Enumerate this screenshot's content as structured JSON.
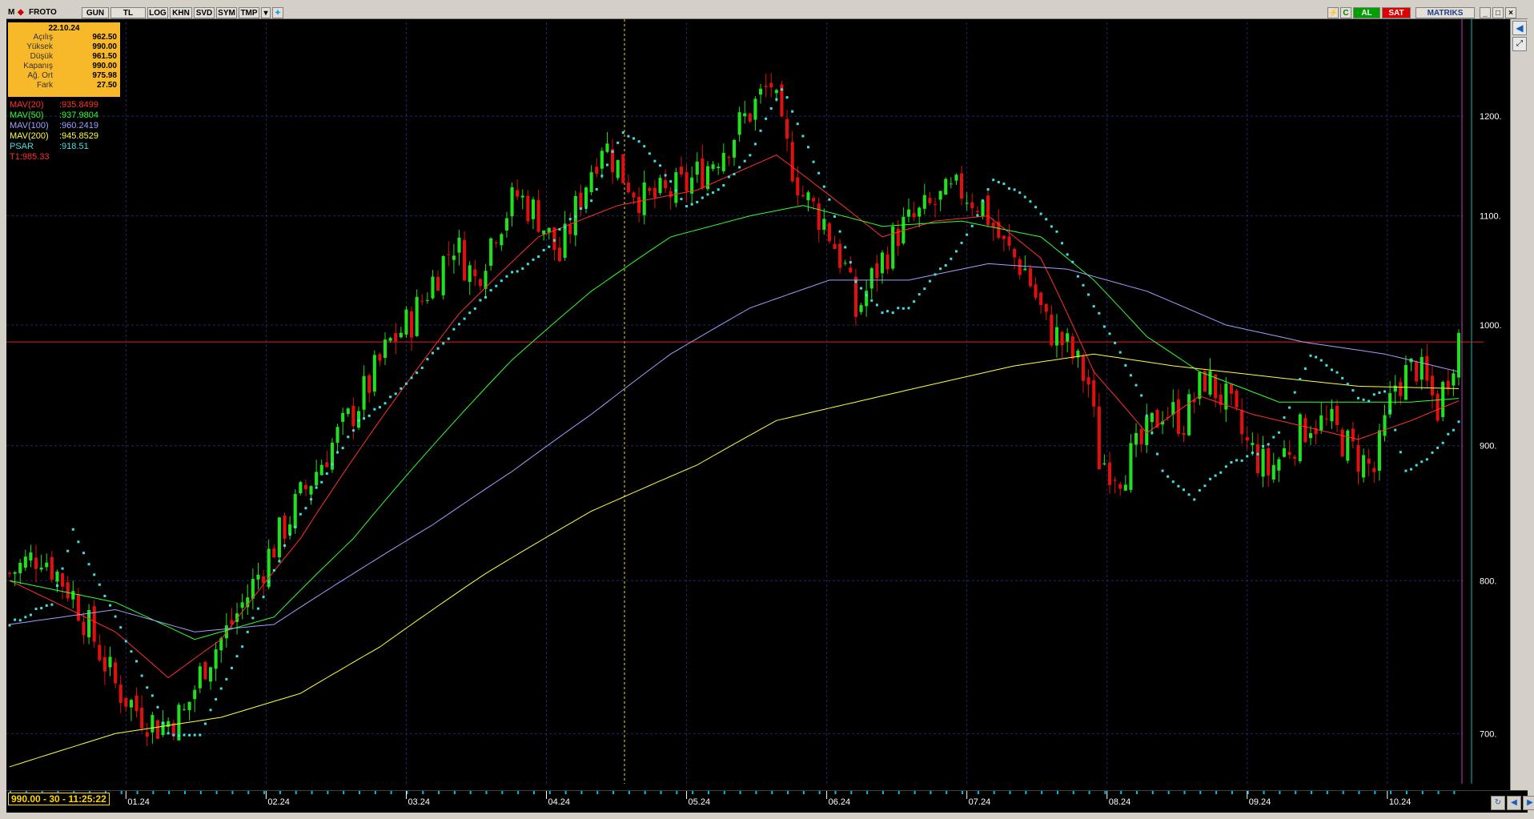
{
  "toolbar": {
    "logo": "M",
    "symbol": "FROTO",
    "buttons": [
      "GUN",
      "TL",
      "LOG",
      "KHN",
      "SVD",
      "SYM",
      "TMP"
    ],
    "right_buttons": {
      "alert": "C",
      "buy": "AL",
      "sell": "SAT"
    },
    "brand": "MATRIKS",
    "colors": {
      "buy": "#00a000",
      "sell": "#e00000"
    }
  },
  "info_box": {
    "date": "22.10.24",
    "rows": [
      {
        "label": "Açılış",
        "value": "962.50"
      },
      {
        "label": "Yüksek",
        "value": "990.00"
      },
      {
        "label": "Düşük",
        "value": "961.50"
      },
      {
        "label": "Kapanış",
        "value": "990.00"
      },
      {
        "label": "Ağ. Ort",
        "value": "975.98"
      },
      {
        "label": "Fark",
        "value": "27.50"
      }
    ]
  },
  "legend": [
    {
      "name": "MAV(20)",
      "value": ":935.8499",
      "color": "#ff3030"
    },
    {
      "name": "MAV(50)",
      "value": ":937.9804",
      "color": "#30ff30"
    },
    {
      "name": "MAV(100)",
      "value": ":960.2419",
      "color": "#a0a0ff"
    },
    {
      "name": "MAV(200)",
      "value": ":945.8529",
      "color": "#ffff40"
    },
    {
      "name": "PSAR",
      "value": ":918.51",
      "color": "#40e0e0"
    },
    {
      "name": "T1:985.33",
      "value": "",
      "color": "#ff3030"
    }
  ],
  "status": {
    "readout": "990.00 - 30 - 11:25:22"
  },
  "chart_data": {
    "type": "candlestick",
    "y_scale": "log",
    "ylim": [
      670,
      1270
    ],
    "y_ticks": [
      "1200.",
      "1100.",
      "1000.",
      "900.",
      "800.",
      "700."
    ],
    "x_ticks": [
      "01.24",
      "02.24",
      "03.24",
      "04.24",
      "05.24",
      "06.24",
      "07.24",
      "08.24",
      "09.24",
      "10.24"
    ],
    "horizontal_line": {
      "label": "T1:985.33",
      "value": 985.33
    },
    "grid": true,
    "close_path": [
      [
        0,
        805
      ],
      [
        6,
        820
      ],
      [
        12,
        790
      ],
      [
        16,
        760
      ],
      [
        20,
        730
      ],
      [
        24,
        715
      ],
      [
        28,
        705
      ],
      [
        33,
        712
      ],
      [
        37,
        745
      ],
      [
        41,
        765
      ],
      [
        45,
        790
      ],
      [
        50,
        825
      ],
      [
        55,
        860
      ],
      [
        60,
        895
      ],
      [
        64,
        920
      ],
      [
        68,
        950
      ],
      [
        72,
        985
      ],
      [
        76,
        1005
      ],
      [
        80,
        1040
      ],
      [
        84,
        1075
      ],
      [
        88,
        1040
      ],
      [
        92,
        1090
      ],
      [
        96,
        1120
      ],
      [
        100,
        1100
      ],
      [
        104,
        1060
      ],
      [
        108,
        1120
      ],
      [
        112,
        1175
      ],
      [
        116,
        1140
      ],
      [
        120,
        1115
      ],
      [
        124,
        1120
      ],
      [
        128,
        1130
      ],
      [
        132,
        1150
      ],
      [
        136,
        1175
      ],
      [
        140,
        1205
      ],
      [
        144,
        1235
      ],
      [
        146,
        1180
      ],
      [
        150,
        1120
      ],
      [
        154,
        1095
      ],
      [
        158,
        1050
      ],
      [
        160,
        1010
      ],
      [
        164,
        1050
      ],
      [
        168,
        1085
      ],
      [
        172,
        1100
      ],
      [
        176,
        1115
      ],
      [
        180,
        1125
      ],
      [
        184,
        1110
      ],
      [
        188,
        1070
      ],
      [
        192,
        1050
      ],
      [
        196,
        1000
      ],
      [
        200,
        980
      ],
      [
        204,
        950
      ],
      [
        206,
        890
      ],
      [
        210,
        880
      ],
      [
        214,
        900
      ],
      [
        218,
        930
      ],
      [
        222,
        920
      ],
      [
        226,
        955
      ],
      [
        230,
        935
      ],
      [
        234,
        900
      ],
      [
        238,
        880
      ],
      [
        242,
        900
      ],
      [
        246,
        920
      ],
      [
        250,
        915
      ],
      [
        254,
        895
      ],
      [
        258,
        880
      ],
      [
        262,
        950
      ],
      [
        266,
        965
      ],
      [
        270,
        930
      ],
      [
        274,
        990
      ]
    ],
    "series": [
      {
        "name": "MAV(20)",
        "color": "#ff3030",
        "points": [
          [
            0,
            800
          ],
          [
            20,
            765
          ],
          [
            30,
            735
          ],
          [
            40,
            760
          ],
          [
            55,
            830
          ],
          [
            70,
            920
          ],
          [
            85,
            1010
          ],
          [
            100,
            1080
          ],
          [
            115,
            1110
          ],
          [
            130,
            1125
          ],
          [
            145,
            1160
          ],
          [
            155,
            1120
          ],
          [
            165,
            1080
          ],
          [
            175,
            1095
          ],
          [
            185,
            1100
          ],
          [
            195,
            1060
          ],
          [
            205,
            960
          ],
          [
            215,
            910
          ],
          [
            225,
            940
          ],
          [
            235,
            925
          ],
          [
            245,
            915
          ],
          [
            255,
            905
          ],
          [
            265,
            920
          ],
          [
            274,
            936
          ]
        ]
      },
      {
        "name": "MAV(50)",
        "color": "#30ff30",
        "points": [
          [
            0,
            800
          ],
          [
            20,
            785
          ],
          [
            35,
            760
          ],
          [
            50,
            775
          ],
          [
            65,
            830
          ],
          [
            80,
            900
          ],
          [
            95,
            970
          ],
          [
            110,
            1030
          ],
          [
            125,
            1080
          ],
          [
            140,
            1100
          ],
          [
            150,
            1110
          ],
          [
            165,
            1090
          ],
          [
            180,
            1095
          ],
          [
            195,
            1080
          ],
          [
            205,
            1040
          ],
          [
            215,
            990
          ],
          [
            225,
            960
          ],
          [
            240,
            935
          ],
          [
            255,
            935
          ],
          [
            265,
            935
          ],
          [
            274,
            938
          ]
        ]
      },
      {
        "name": "MAV(100)",
        "color": "#a0a0ff",
        "points": [
          [
            0,
            770
          ],
          [
            20,
            780
          ],
          [
            35,
            765
          ],
          [
            50,
            770
          ],
          [
            65,
            805
          ],
          [
            80,
            840
          ],
          [
            95,
            880
          ],
          [
            110,
            925
          ],
          [
            125,
            975
          ],
          [
            140,
            1015
          ],
          [
            155,
            1040
          ],
          [
            170,
            1040
          ],
          [
            185,
            1055
          ],
          [
            200,
            1050
          ],
          [
            215,
            1030
          ],
          [
            230,
            1000
          ],
          [
            245,
            985
          ],
          [
            260,
            975
          ],
          [
            274,
            960
          ]
        ]
      },
      {
        "name": "MAV(200)",
        "color": "#ffff40",
        "points": [
          [
            0,
            680
          ],
          [
            20,
            700
          ],
          [
            40,
            710
          ],
          [
            55,
            725
          ],
          [
            70,
            755
          ],
          [
            90,
            805
          ],
          [
            110,
            850
          ],
          [
            130,
            885
          ],
          [
            145,
            920
          ],
          [
            160,
            935
          ],
          [
            175,
            950
          ],
          [
            190,
            965
          ],
          [
            205,
            975
          ],
          [
            220,
            965
          ],
          [
            240,
            955
          ],
          [
            255,
            948
          ],
          [
            274,
            946
          ]
        ]
      },
      {
        "name": "PSAR",
        "color": "#40e0e0",
        "style": "dots",
        "points": [
          [
            0,
            770
          ],
          [
            8,
            785
          ],
          [
            12,
            835
          ],
          [
            18,
            790
          ],
          [
            24,
            745
          ],
          [
            30,
            700
          ],
          [
            36,
            700
          ],
          [
            42,
            740
          ],
          [
            48,
            790
          ],
          [
            54,
            840
          ],
          [
            60,
            880
          ],
          [
            66,
            920
          ],
          [
            70,
            930
          ],
          [
            76,
            955
          ],
          [
            82,
            985
          ],
          [
            88,
            1015
          ],
          [
            94,
            1045
          ],
          [
            100,
            1060
          ],
          [
            104,
            1085
          ],
          [
            110,
            1115
          ],
          [
            116,
            1185
          ],
          [
            120,
            1170
          ],
          [
            128,
            1110
          ],
          [
            134,
            1125
          ],
          [
            140,
            1160
          ],
          [
            146,
            1230
          ],
          [
            150,
            1180
          ],
          [
            154,
            1130
          ],
          [
            160,
            1040
          ],
          [
            165,
            1010
          ],
          [
            170,
            1015
          ],
          [
            174,
            1040
          ],
          [
            178,
            1060
          ],
          [
            182,
            1090
          ],
          [
            186,
            1135
          ],
          [
            192,
            1120
          ],
          [
            198,
            1085
          ],
          [
            204,
            1025
          ],
          [
            210,
            975
          ],
          [
            214,
            940
          ],
          [
            218,
            880
          ],
          [
            224,
            860
          ],
          [
            230,
            885
          ],
          [
            236,
            895
          ],
          [
            240,
            910
          ],
          [
            246,
            975
          ],
          [
            252,
            955
          ],
          [
            256,
            935
          ],
          [
            260,
            945
          ],
          [
            264,
            880
          ],
          [
            268,
            890
          ],
          [
            274,
            918
          ]
        ]
      }
    ]
  }
}
